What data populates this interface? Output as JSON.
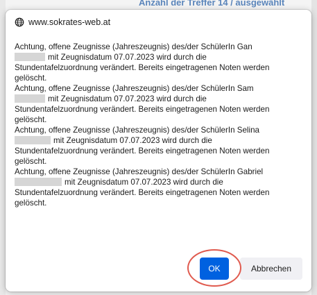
{
  "background": {
    "header_text": "Anzahl der Treffer   14 / ausgewählt"
  },
  "dialog": {
    "origin": "www.sokrates-web.at",
    "messages": [
      {
        "line1": "Achtung, offene Zeugnisse (Jahreszeugnis) des/der SchülerIn Gan",
        "line2": "mit Zeugnisdatum 07.07.2023 wird durch die",
        "line3": "Stundentafelzuordnung verändert. Bereits eingetragenen Noten werden gelöscht."
      },
      {
        "line1": "Achtung, offene Zeugnisse (Jahreszeugnis) des/der SchülerIn Sam",
        "line2": "mit Zeugnisdatum 07.07.2023 wird durch die",
        "line3": "Stundentafelzuordnung verändert. Bereits eingetragenen Noten werden gelöscht."
      },
      {
        "line1": "Achtung, offene Zeugnisse (Jahreszeugnis) des/der SchülerIn Selina",
        "line2": "mit Zeugnisdatum 07.07.2023 wird durch die",
        "line3": "Stundentafelzuordnung verändert. Bereits eingetragenen Noten werden gelöscht."
      },
      {
        "line1": "Achtung, offene Zeugnisse (Jahreszeugnis) des/der SchülerIn Gabriel",
        "line2": "mit Zeugnisdatum 07.07.2023 wird durch die",
        "line3": "Stundentafelzuordnung verändert. Bereits eingetragenen Noten werden gelöscht."
      }
    ],
    "ok_label": "OK",
    "cancel_label": "Abbrechen"
  },
  "colors": {
    "ok_button": "#0061e0",
    "highlight_ring": "#e05a4e",
    "background_header": "#4a79b5"
  }
}
